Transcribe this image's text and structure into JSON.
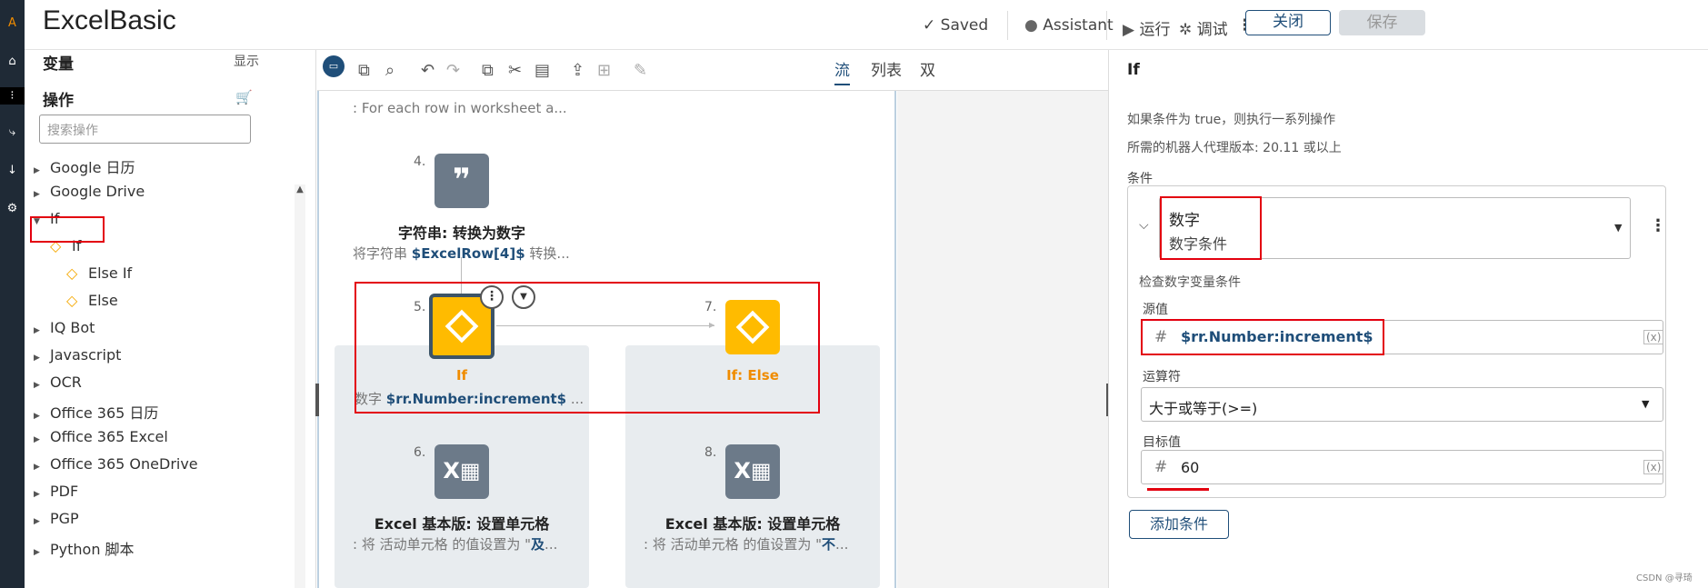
{
  "app": {
    "title": "ExcelBasic"
  },
  "topbar": {
    "saved": "✓ Saved",
    "assistant": "Assistant",
    "run": "运行",
    "debug": "调试",
    "close": "关闭",
    "save": "保存"
  },
  "left": {
    "variables": "变量",
    "show": "显示",
    "actions": "操作",
    "search_placeholder": "搜索操作",
    "items": [
      "Google 日历",
      "Google Drive",
      "If",
      "If",
      "Else If",
      "Else",
      "IQ Bot",
      "Javascript",
      "OCR",
      "Office 365 日历",
      "Office 365 Excel",
      "Office 365 OneDrive",
      "PDF",
      "PGP",
      "Python 脚本"
    ]
  },
  "canvas": {
    "views": [
      "流",
      "列表",
      "双"
    ],
    "loop_text": ": For each row in worksheet a...",
    "nodes": [
      {
        "num": "4.",
        "title": "字符串: 转换为数字",
        "subtitle_prefix": "将字符串 ",
        "subtitle_var": "$ExcelRow[4]$",
        "subtitle_suffix": " 转换..."
      },
      {
        "num": "5.",
        "title": "If",
        "subtitle_prefix": "数字 ",
        "subtitle_var": "$rr.Number:increment$",
        "subtitle_suffix": " ..."
      },
      {
        "num": "7.",
        "title": "If: Else"
      },
      {
        "num": "6.",
        "title": "Excel 基本版: 设置单元格",
        "subtitle_prefix": ": 将 活动单元格 的值设置为 \"",
        "subtitle_bold": "及",
        "subtitle_suffix": "..."
      },
      {
        "num": "8.",
        "title": "Excel 基本版: 设置单元格",
        "subtitle_prefix": ": 将 活动单元格 的值设置为 \"",
        "subtitle_bold": "不",
        "subtitle_suffix": "..."
      }
    ]
  },
  "right": {
    "title": "If",
    "desc1": "如果条件为 true，则执行一系列操作",
    "desc2": "所需的机器人代理版本: 20.11 或以上",
    "conditions": "条件",
    "cond_type": "数字",
    "cond_sub": "数字条件",
    "check_label": "检查数字变量条件",
    "source_label": "源值",
    "source_value": "$rr.Number:increment$",
    "operator_label": "运算符",
    "operator_value": "大于或等于(>=)",
    "target_label": "目标值",
    "target_value": "60",
    "add_condition": "添加条件",
    "varbtn": "(x)",
    "hash": "#",
    "watermark": "CSDN @寻琦"
  },
  "colors": {
    "accent": "#1f4e79",
    "node_gray": "#6c7a89",
    "node_yellow": "#ffbb00",
    "highlight": "#e3000f",
    "orange_text": "#f08c00"
  }
}
